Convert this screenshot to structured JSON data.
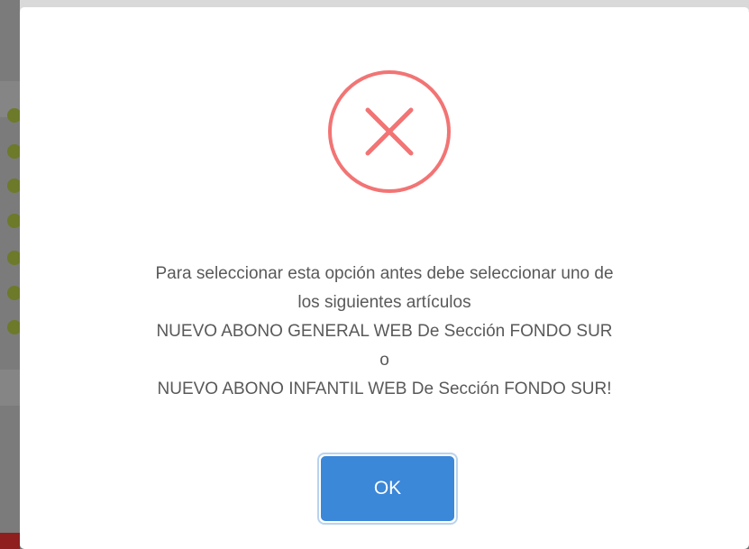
{
  "dialog": {
    "icon": "error-x-icon",
    "message_lines": [
      "Para seleccionar esta opción antes debe seleccionar uno de",
      "los siguientes artículos",
      "NUEVO ABONO GENERAL WEB De Sección FONDO SUR",
      "o",
      "NUEVO ABONO INFANTIL WEB De Sección FONDO SUR!"
    ],
    "ok_label": "OK"
  },
  "colors": {
    "error_ring": "#f27474",
    "button_bg": "#3b87d8",
    "button_focus_ring": "#b8d3ee",
    "text": "#595959"
  }
}
